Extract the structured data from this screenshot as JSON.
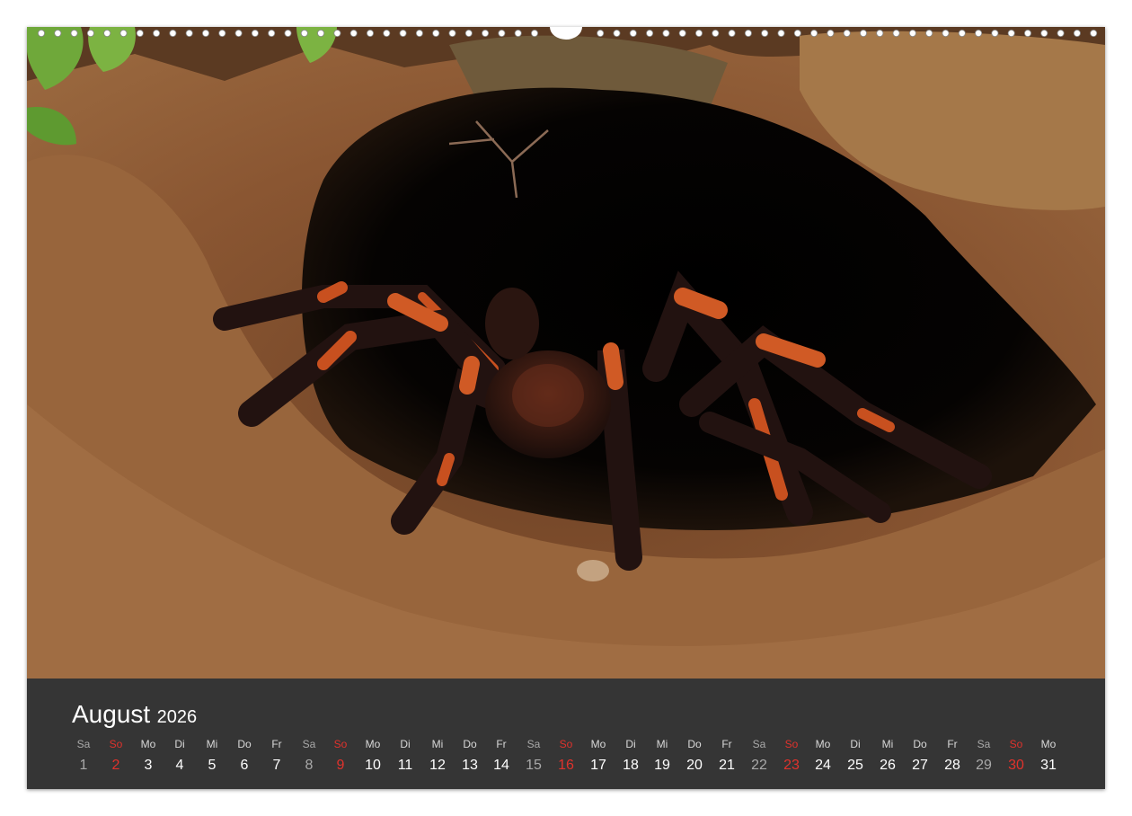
{
  "calendar": {
    "month": "August",
    "year": "2026",
    "days": [
      {
        "dow": "Sa",
        "num": "1",
        "kind": "sat"
      },
      {
        "dow": "So",
        "num": "2",
        "kind": "sun"
      },
      {
        "dow": "Mo",
        "num": "3",
        "kind": "week"
      },
      {
        "dow": "Di",
        "num": "4",
        "kind": "week"
      },
      {
        "dow": "Mi",
        "num": "5",
        "kind": "week"
      },
      {
        "dow": "Do",
        "num": "6",
        "kind": "week"
      },
      {
        "dow": "Fr",
        "num": "7",
        "kind": "week"
      },
      {
        "dow": "Sa",
        "num": "8",
        "kind": "sat"
      },
      {
        "dow": "So",
        "num": "9",
        "kind": "sun"
      },
      {
        "dow": "Mo",
        "num": "10",
        "kind": "week"
      },
      {
        "dow": "Di",
        "num": "11",
        "kind": "week"
      },
      {
        "dow": "Mi",
        "num": "12",
        "kind": "week"
      },
      {
        "dow": "Do",
        "num": "13",
        "kind": "week"
      },
      {
        "dow": "Fr",
        "num": "14",
        "kind": "week"
      },
      {
        "dow": "Sa",
        "num": "15",
        "kind": "sat"
      },
      {
        "dow": "So",
        "num": "16",
        "kind": "sun"
      },
      {
        "dow": "Mo",
        "num": "17",
        "kind": "week"
      },
      {
        "dow": "Di",
        "num": "18",
        "kind": "week"
      },
      {
        "dow": "Mi",
        "num": "19",
        "kind": "week"
      },
      {
        "dow": "Do",
        "num": "20",
        "kind": "week"
      },
      {
        "dow": "Fr",
        "num": "21",
        "kind": "week"
      },
      {
        "dow": "Sa",
        "num": "22",
        "kind": "sat"
      },
      {
        "dow": "So",
        "num": "23",
        "kind": "sun"
      },
      {
        "dow": "Mo",
        "num": "24",
        "kind": "week"
      },
      {
        "dow": "Di",
        "num": "25",
        "kind": "week"
      },
      {
        "dow": "Mi",
        "num": "26",
        "kind": "week"
      },
      {
        "dow": "Do",
        "num": "27",
        "kind": "week"
      },
      {
        "dow": "Fr",
        "num": "28",
        "kind": "week"
      },
      {
        "dow": "Sa",
        "num": "29",
        "kind": "sat"
      },
      {
        "dow": "So",
        "num": "30",
        "kind": "sun"
      },
      {
        "dow": "Mo",
        "num": "31",
        "kind": "week"
      }
    ]
  },
  "colors": {
    "panel_background": "#353535",
    "weekday_text": "#ffffff",
    "saturday_text": "#a9a9a9",
    "sunday_text": "#e0322c"
  },
  "photo": {
    "subject_icon": "tarantula-in-burrow-illustration"
  }
}
